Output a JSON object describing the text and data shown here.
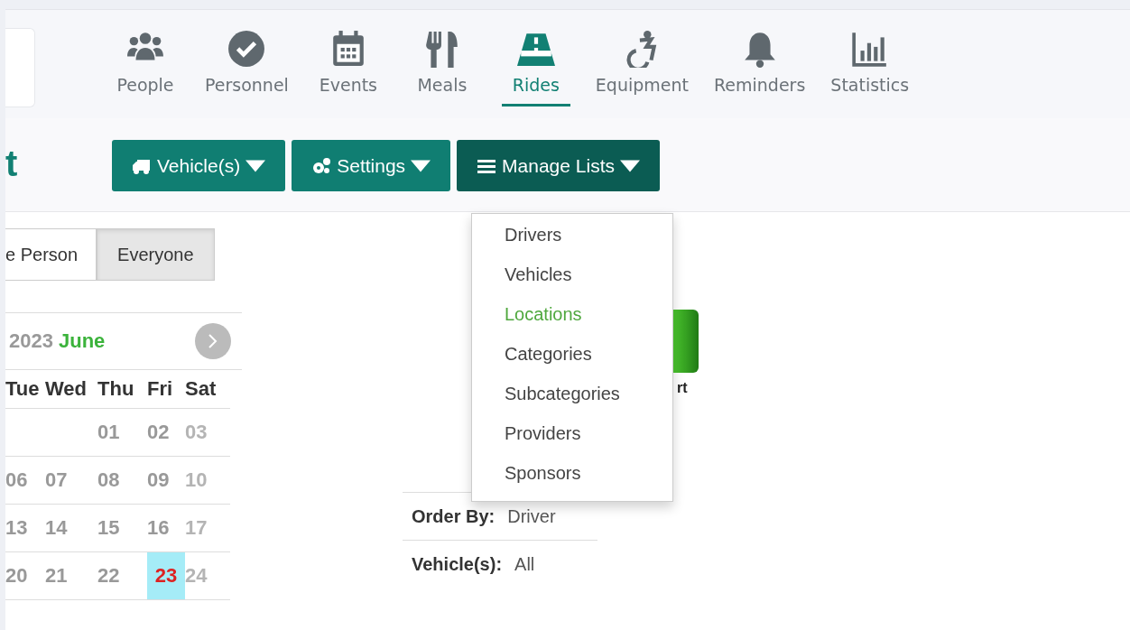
{
  "nav": [
    {
      "label": "People",
      "selected": false
    },
    {
      "label": "Personnel",
      "selected": false
    },
    {
      "label": "Events",
      "selected": false
    },
    {
      "label": "Meals",
      "selected": false
    },
    {
      "label": "Rides",
      "selected": true
    },
    {
      "label": "Equipment",
      "selected": false
    },
    {
      "label": "Reminders",
      "selected": false
    },
    {
      "label": "Statistics",
      "selected": false
    }
  ],
  "page_title": "t",
  "toolbar": [
    {
      "label": "Vehicle(s)",
      "expanded": false
    },
    {
      "label": "Settings",
      "expanded": false
    },
    {
      "label": "Manage Lists",
      "expanded": true
    }
  ],
  "menu": [
    {
      "label": "Drivers",
      "selected": false
    },
    {
      "label": "Vehicles",
      "selected": false
    },
    {
      "label": "Locations",
      "selected": true
    },
    {
      "label": "Categories",
      "selected": false
    },
    {
      "label": "Subcategories",
      "selected": false
    },
    {
      "label": "Providers",
      "selected": false
    },
    {
      "label": "Sponsors",
      "selected": false
    }
  ],
  "scope": [
    {
      "label": "e Person",
      "selected": false
    },
    {
      "label": "Everyone",
      "selected": true
    }
  ],
  "calendar": {
    "year": "2023",
    "month": "June",
    "weekdays": [
      "Tue",
      "Wed",
      "Thu",
      "Fri",
      "Sat"
    ],
    "weeks": [
      [
        {
          "kind": "blank"
        },
        {
          "kind": "blank"
        },
        {
          "day": "01",
          "kind": "weekday",
          "today": false
        },
        {
          "day": "02",
          "kind": "weekday",
          "today": false
        },
        {
          "day": "03",
          "kind": "weekend",
          "today": false
        }
      ],
      [
        {
          "day": "06",
          "kind": "weekday",
          "today": false
        },
        {
          "day": "07",
          "kind": "weekday",
          "today": false
        },
        {
          "day": "08",
          "kind": "weekday",
          "today": false
        },
        {
          "day": "09",
          "kind": "weekday",
          "today": false
        },
        {
          "day": "10",
          "kind": "weekend",
          "today": false
        }
      ],
      [
        {
          "day": "13",
          "kind": "weekday",
          "today": false
        },
        {
          "day": "14",
          "kind": "weekday",
          "today": false
        },
        {
          "day": "15",
          "kind": "weekday",
          "today": false
        },
        {
          "day": "16",
          "kind": "weekday",
          "today": false
        },
        {
          "day": "17",
          "kind": "weekend",
          "today": false
        }
      ],
      [
        {
          "day": "20",
          "kind": "weekday",
          "today": false
        },
        {
          "day": "21",
          "kind": "weekday",
          "today": false
        },
        {
          "day": "22",
          "kind": "weekday",
          "today": false
        },
        {
          "day": "23",
          "kind": "weekday",
          "today": true
        },
        {
          "day": "24",
          "kind": "weekend",
          "today": false
        }
      ]
    ]
  },
  "report_tile": {
    "label": "rt"
  },
  "filters": [
    {
      "label": "Order By:",
      "value": "Driver"
    },
    {
      "label": "Vehicle(s):",
      "value": "All"
    }
  ]
}
